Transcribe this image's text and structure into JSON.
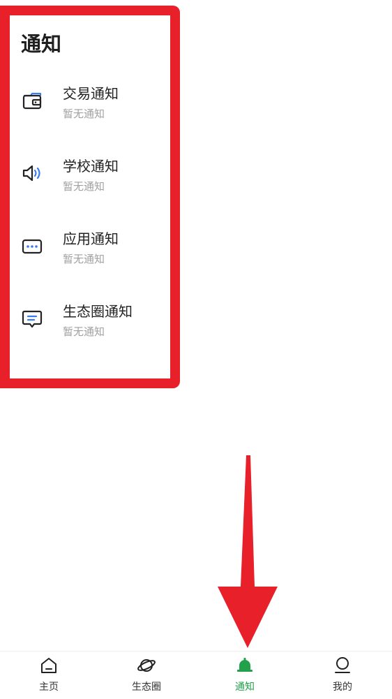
{
  "page": {
    "title": "通知"
  },
  "notices": [
    {
      "icon": "wallet-icon",
      "title": "交易通知",
      "subtitle": "暂无通知"
    },
    {
      "icon": "speaker-icon",
      "title": "学校通知",
      "subtitle": "暂无通知"
    },
    {
      "icon": "app-message-icon",
      "title": "应用通知",
      "subtitle": "暂无通知"
    },
    {
      "icon": "chat-bubble-icon",
      "title": "生态圈通知",
      "subtitle": "暂无通知"
    }
  ],
  "tabbar": {
    "items": [
      {
        "label": "主页",
        "icon": "home-icon",
        "active": false
      },
      {
        "label": "生态圈",
        "icon": "planet-icon",
        "active": false
      },
      {
        "label": "通知",
        "icon": "bell-icon",
        "active": true
      },
      {
        "label": "我的",
        "icon": "profile-icon",
        "active": false
      }
    ]
  },
  "colors": {
    "highlight": "#e8202a",
    "accent_blue": "#3a7bf0",
    "active_green": "#23a04a",
    "subtitle_gray": "#a0a0a0"
  }
}
